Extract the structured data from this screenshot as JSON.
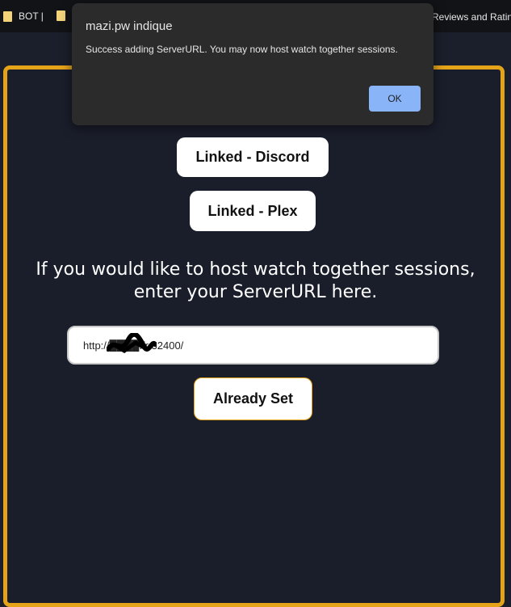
{
  "bookmarks": {
    "items": [
      {
        "label": "BOT |"
      },
      {
        "label": ""
      }
    ],
    "right_label": "Reviews and Rating"
  },
  "main": {
    "discord_label": "Linked - Discord",
    "plex_label": "Linked - Plex",
    "headline_line1": "If you would like to host watch together sessions,",
    "headline_line2": "enter your ServerURL here.",
    "server_url_value": "http://████.fr:32400/",
    "already_set_label": "Already Set"
  },
  "dialog": {
    "title": "mazi.pw indique",
    "message": "Success adding ServerURL. You may now host watch together sessions.",
    "ok_label": "OK"
  },
  "colors": {
    "accent": "#e5a31a",
    "background": "#1b1f2b",
    "dialog_bg": "#2b2b2b",
    "ok_button": "#8ab4f8"
  },
  "icons": [
    "folder-icon",
    "redaction-scribble"
  ]
}
